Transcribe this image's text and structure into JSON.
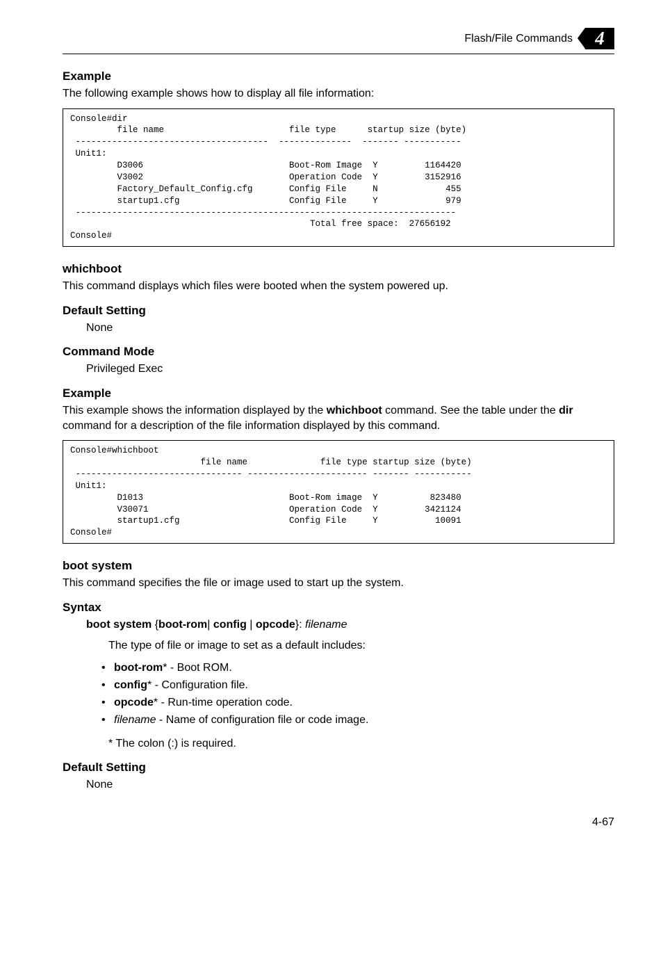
{
  "header": {
    "title": "Flash/File Commands",
    "badge": "4"
  },
  "sections": {
    "example1": {
      "heading": "Example",
      "intro": "The following example shows how to display all file information:",
      "console": "Console#dir\n         file name                        file type      startup size (byte)\n -------------------------------------  --------------  ------- -----------\n Unit1:\n         D3006                            Boot-Rom Image  Y         1164420\n         V3002                            Operation Code  Y         3152916\n         Factory_Default_Config.cfg       Config File     N             455\n         startup1.cfg                     Config File     Y             979\n -------------------------------------------------------------------------\n                                              Total free space:  27656192\nConsole#"
    },
    "whichboot": {
      "heading": "whichboot",
      "intro": "This command displays which files were booted when the system powered up.",
      "default_heading": "Default Setting",
      "default_value": "None",
      "cmdmode_heading": "Command Mode",
      "cmdmode_value": "Privileged Exec",
      "example_heading": "Example",
      "example_intro_pre": "This example shows the information displayed by the ",
      "example_intro_cmd": "whichboot",
      "example_intro_mid": " command. See the table under the ",
      "example_intro_cmd2": "dir",
      "example_intro_post": " command for a description of the file information displayed by this command.",
      "console": "Console#whichboot\n                         file name              file type startup size (byte)\n -------------------------------- ----------------------- ------- -----------\n Unit1:\n         D1013                            Boot-Rom image  Y          823480\n         V30071                           Operation Code  Y         3421124\n         startup1.cfg                     Config File     Y           10091\nConsole#"
    },
    "bootsystem": {
      "heading": "boot system",
      "intro": "This command specifies the file or image used to start up the system.",
      "syntax_heading": "Syntax",
      "syntax_prefix": "boot system",
      "syntax_open": " {",
      "syntax_opt1": "boot-rom",
      "syntax_bar1": "| ",
      "syntax_opt2": "config",
      "syntax_bar2": " | ",
      "syntax_opt3": "opcode",
      "syntax_close": "}: ",
      "syntax_filename": "filename",
      "syntax_desc": "The type of file or image to set as a default includes:",
      "bullets": [
        {
          "term": "boot-rom",
          "term_suffix": "*",
          "desc": " - Boot ROM."
        },
        {
          "term": "config",
          "term_suffix": "*",
          "desc": " - Configuration file."
        },
        {
          "term": "opcode",
          "term_suffix": "*",
          "desc": " - Run-time operation code."
        },
        {
          "term_ital": "filename",
          "desc": " - Name of configuration file or code image."
        }
      ],
      "star_note": "* The colon (:) is required.",
      "default_heading": "Default Setting",
      "default_value": "None"
    }
  },
  "footer": {
    "page_number": "4-67"
  }
}
